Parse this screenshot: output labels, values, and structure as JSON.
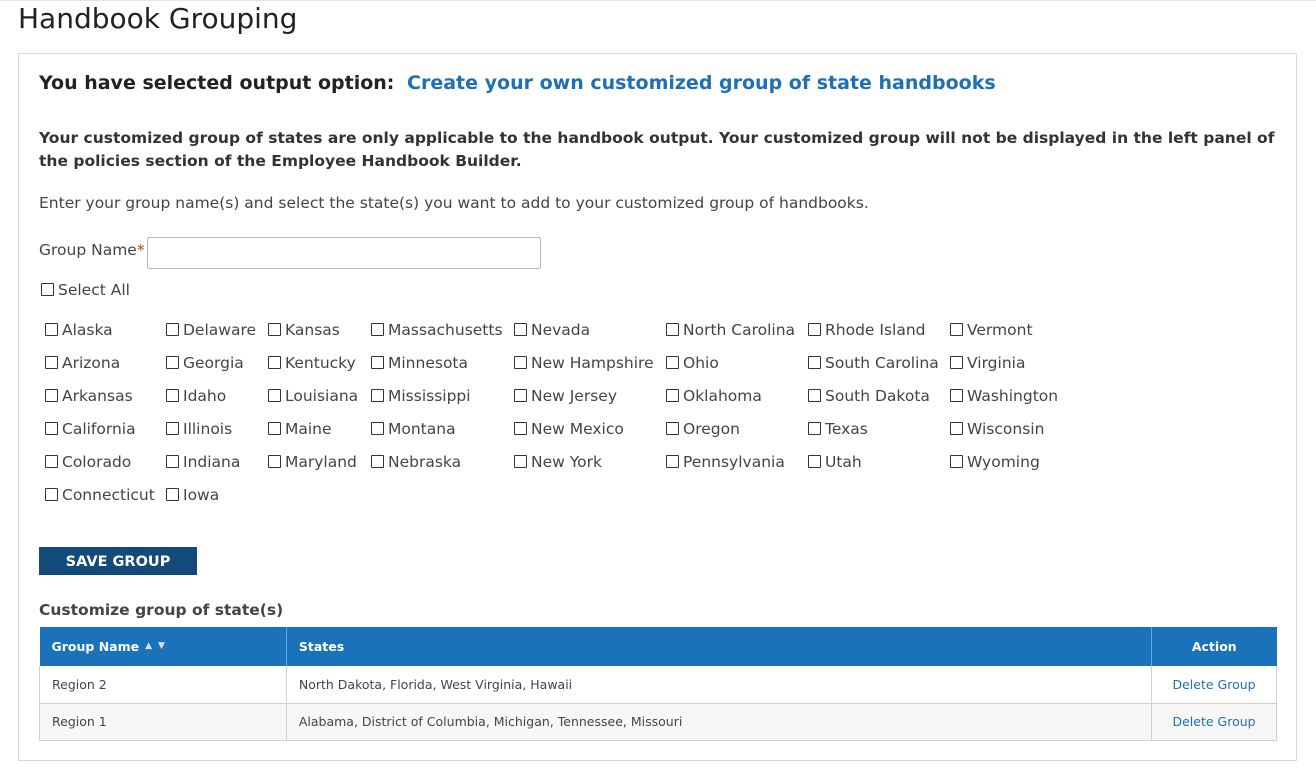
{
  "page": {
    "title": "Handbook Grouping"
  },
  "output_option": {
    "prefix": "You have selected output option:",
    "value": "Create your own customized group of state handbooks"
  },
  "notice": "Your customized group of states are only applicable to the handbook output. Your customized group will not be displayed in the left panel of the policies section of the Employee Handbook Builder.",
  "instructions": "Enter your group name(s) and select the state(s) you want to add to your customized group of handbooks.",
  "group_name": {
    "label": "Group Name",
    "required_mark": "*",
    "value": ""
  },
  "select_all_label": "Select All",
  "states": {
    "col1": [
      "Alaska",
      "Arizona",
      "Arkansas",
      "California",
      "Colorado",
      "Connecticut"
    ],
    "col2": [
      "Delaware",
      "Georgia",
      "Idaho",
      "Illinois",
      "Indiana",
      "Iowa"
    ],
    "col3": [
      "Kansas",
      "Kentucky",
      "Louisiana",
      "Maine",
      "Maryland"
    ],
    "col4": [
      "Massachusetts",
      "Minnesota",
      "Mississippi",
      "Montana",
      "Nebraska"
    ],
    "col5": [
      "Nevada",
      "New Hampshire",
      "New Jersey",
      "New Mexico",
      "New York"
    ],
    "col6": [
      "North Carolina",
      "Ohio",
      "Oklahoma",
      "Oregon",
      "Pennsylvania"
    ],
    "col7": [
      "Rhode Island",
      "South Carolina",
      "South Dakota",
      "Texas",
      "Utah"
    ],
    "col8": [
      "Vermont",
      "Virginia",
      "Washington",
      "Wisconsin",
      "Wyoming"
    ]
  },
  "save_button_label": "SAVE GROUP",
  "groups_table": {
    "title": "Customize group of state(s)",
    "columns": [
      "Group Name",
      "States",
      "Action"
    ],
    "rows": [
      {
        "name": "Region 2",
        "states": "North Dakota, Florida, West Virginia, Hawaii",
        "action": "Delete Group"
      },
      {
        "name": "Region 1",
        "states": "Alabama, District of Columbia, Michigan, Tennessee, Missouri",
        "action": "Delete Group"
      }
    ]
  },
  "colors": {
    "accent_link": "#1f6fb5",
    "button_bg": "#124a7a",
    "table_header_bg": "#1a73ba"
  }
}
